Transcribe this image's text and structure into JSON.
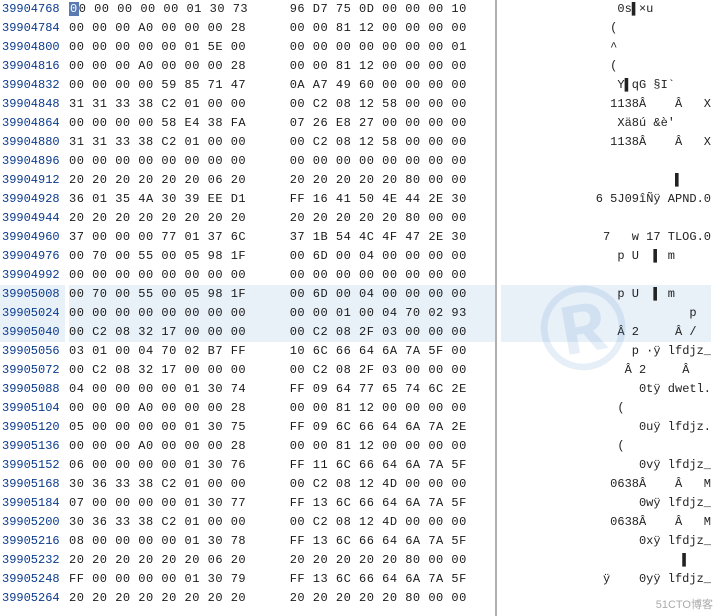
{
  "watermark": "®",
  "corner_text": "51CTO博客",
  "rows": [
    {
      "off": "39904768",
      "h1": "00 00 00 00 00 01 30 73",
      "h2": " 96 D7 75 0D 00 00 00 10",
      "asc": "0s▌×u        ",
      "hl": false,
      "cursor": true
    },
    {
      "off": "39904784",
      "h1": "00 00 00 A0 00 00 00 28",
      "h2": " 00 00 81 12 00 00 00 00",
      "asc": "(             ",
      "hl": false
    },
    {
      "off": "39904800",
      "h1": "00 00 00 00 00 01 5E 00",
      "h2": " 00 00 00 00 00 00 00 01",
      "asc": "^             ",
      "hl": false
    },
    {
      "off": "39904816",
      "h1": "00 00 00 A0 00 00 00 28",
      "h2": " 00 00 81 12 00 00 00 00",
      "asc": "(             ",
      "hl": false
    },
    {
      "off": "39904832",
      "h1": "00 00 00 00 59 85 71 47",
      "h2": " 0A A7 49 60 00 00 00 00",
      "asc": "Y▌qG §I`     ",
      "hl": false
    },
    {
      "off": "39904848",
      "h1": "31 31 33 38 C2 01 00 00",
      "h2": " 00 C2 08 12 58 00 00 00",
      "asc": "1138Â    Â   X",
      "hl": false
    },
    {
      "off": "39904864",
      "h1": "00 00 00 00 58 E4 38 FA",
      "h2": " 07 26 E8 27 00 00 00 00",
      "asc": "Xä8ú &è'     ",
      "hl": false
    },
    {
      "off": "39904880",
      "h1": "31 31 33 38 C2 01 00 00",
      "h2": " 00 C2 08 12 58 00 00 00",
      "asc": "1138Â    Â   X",
      "hl": false
    },
    {
      "off": "39904896",
      "h1": "00 00 00 00 00 00 00 00",
      "h2": " 00 00 00 00 00 00 00 00",
      "asc": "              ",
      "hl": false
    },
    {
      "off": "39904912",
      "h1": "20 20 20 20 20 20 06 20",
      "h2": " 20 20 20 20 20 80 00 00",
      "asc": "▌    ",
      "hl": false
    },
    {
      "off": "39904928",
      "h1": "36 01 35 4A 30 39 EE D1",
      "h2": " FF 16 41 50 4E 44 2E 30",
      "asc": "6 5J09îÑÿ APND.0",
      "hl": false
    },
    {
      "off": "39904944",
      "h1": "20 20 20 20 20 20 20 20",
      "h2": " 20 20 20 20 20 80 00 00",
      "asc": "              ",
      "hl": false
    },
    {
      "off": "39904960",
      "h1": "37 00 00 00 77 01 37 6C",
      "h2": " 37 1B 54 4C 4F 47 2E 30",
      "asc": "7   w 17 TLOG.0",
      "hl": false
    },
    {
      "off": "39904976",
      "h1": "00 70 00 55 00 05 98 1F",
      "h2": " 00 6D 00 04 00 00 00 00",
      "asc": "p U  ▌ m     ",
      "hl": false
    },
    {
      "off": "39904992",
      "h1": "00 00 00 00 00 00 00 00",
      "h2": " 00 00 00 00 00 00 00 00",
      "asc": "              ",
      "hl": false
    },
    {
      "off": "39905008",
      "h1": "00 70 00 55 00 05 98 1F",
      "h2": " 00 6D 00 04 00 00 00 00",
      "asc": "p U  ▌ m     ",
      "hl": true
    },
    {
      "off": "39905024",
      "h1": "00 00 00 00 00 00 00 00",
      "h2": " 00 00 01 00 04 70 02 93",
      "asc": "p  ",
      "hl": true
    },
    {
      "off": "39905040",
      "h1": "00 C2 08 32 17 00 00 00",
      "h2": " 00 C2 08 2F 03 00 00 00",
      "asc": "Â 2     Â /  ",
      "hl": true
    },
    {
      "off": "39905056",
      "h1": "03 01 00 04 70 02 B7 FF",
      "h2": " 10 6C 66 64 6A 7A 5F 00",
      "asc": "p ·ÿ lfdjz_",
      "hl": false
    },
    {
      "off": "39905072",
      "h1": "00 C2 08 32 17 00 00 00",
      "h2": " 00 C2 08 2F 03 00 00 00",
      "asc": "Â 2     Â   ",
      "hl": false
    },
    {
      "off": "39905088",
      "h1": "04 00 00 00 00 01 30 74",
      "h2": " FF 09 64 77 65 74 6C 2E",
      "asc": "0tÿ dwetl.",
      "hl": false
    },
    {
      "off": "39905104",
      "h1": "00 00 00 A0 00 00 00 28",
      "h2": " 00 00 81 12 00 00 00 00",
      "asc": "(            ",
      "hl": false
    },
    {
      "off": "39905120",
      "h1": "05 00 00 00 00 01 30 75",
      "h2": " FF 09 6C 66 64 6A 7A 2E",
      "asc": "0uÿ lfdjz.",
      "hl": false
    },
    {
      "off": "39905136",
      "h1": "00 00 00 A0 00 00 00 28",
      "h2": " 00 00 81 12 00 00 00 00",
      "asc": "(            ",
      "hl": false
    },
    {
      "off": "39905152",
      "h1": "06 00 00 00 00 01 30 76",
      "h2": " FF 11 6C 66 64 6A 7A 5F",
      "asc": "0vÿ lfdjz_",
      "hl": false
    },
    {
      "off": "39905168",
      "h1": "30 36 33 38 C2 01 00 00",
      "h2": " 00 C2 08 12 4D 00 00 00",
      "asc": "0638Â    Â   M",
      "hl": false
    },
    {
      "off": "39905184",
      "h1": "07 00 00 00 00 01 30 77",
      "h2": " FF 13 6C 66 64 6A 7A 5F",
      "asc": "0wÿ lfdjz_",
      "hl": false
    },
    {
      "off": "39905200",
      "h1": "30 36 33 38 C2 01 00 00",
      "h2": " 00 C2 08 12 4D 00 00 00",
      "asc": "0638Â    Â   M",
      "hl": false
    },
    {
      "off": "39905216",
      "h1": "08 00 00 00 00 01 30 78",
      "h2": " FF 13 6C 66 64 6A 7A 5F",
      "asc": "0xÿ lfdjz_",
      "hl": false
    },
    {
      "off": "39905232",
      "h1": "20 20 20 20 20 20 06 20",
      "h2": " 20 20 20 20 20 80 00 00",
      "asc": "▌   ",
      "hl": false
    },
    {
      "off": "39905248",
      "h1": "FF 00 00 00 00 01 30 79",
      "h2": " FF 13 6C 66 64 6A 7A 5F",
      "asc": "ÿ    0yÿ lfdjz_",
      "hl": false
    },
    {
      "off": "39905264",
      "h1": "20 20 20 20 20 20 20 20",
      "h2": " 20 20 20 20 20 80 00 00",
      "asc": "              ",
      "hl": false
    }
  ]
}
